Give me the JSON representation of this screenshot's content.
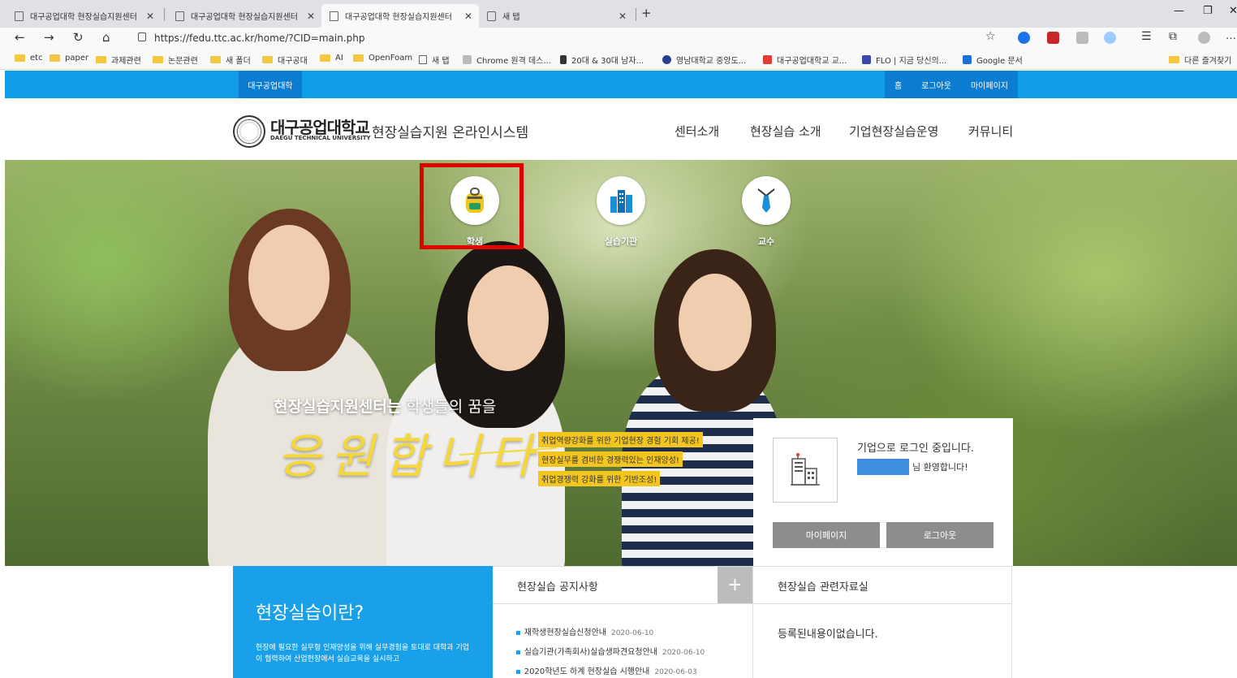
{
  "browser": {
    "tabs": [
      {
        "title": "대구공업대학 현장실습지원센터"
      },
      {
        "title": "대구공업대학 현장실습지원센터"
      },
      {
        "title": "대구공업대학 현장실습지원센터"
      },
      {
        "title": "새 탭"
      }
    ],
    "url": "https://fedu.ttc.ac.kr/home/?CID=main.php",
    "bookmarks": [
      {
        "label": "etc",
        "icon": "folder-icon"
      },
      {
        "label": "paper",
        "icon": "folder-icon"
      },
      {
        "label": "과제관련",
        "icon": "folder-icon"
      },
      {
        "label": "논문관련",
        "icon": "folder-icon"
      },
      {
        "label": "새 폴더",
        "icon": "folder-icon"
      },
      {
        "label": "대구공대",
        "icon": "folder-icon"
      },
      {
        "label": "AI",
        "icon": "folder-icon"
      },
      {
        "label": "OpenFoam",
        "icon": "folder-icon"
      },
      {
        "label": "새 탭",
        "icon": "page-icon"
      },
      {
        "label": "Chrome 원격 데스...",
        "icon": "remote-icon"
      },
      {
        "label": "20대 & 30대 남자...",
        "icon": "site-icon"
      },
      {
        "label": "영남대학교 중앙도...",
        "icon": "site-icon"
      },
      {
        "label": "대구공업대학교 교...",
        "icon": "site-icon"
      },
      {
        "label": "FLO | 지금 당신의...",
        "icon": "site-icon"
      },
      {
        "label": "Google 문서",
        "icon": "docs-icon"
      }
    ],
    "other_bookmarks": "다른 즐겨찾기"
  },
  "site": {
    "topbar": {
      "left_label": "대구공업대학",
      "links": [
        "홈",
        "로그아웃",
        "마이페이지"
      ]
    },
    "header": {
      "logo_kr": "대구공업대학교",
      "logo_en": "DAEGU TECHNICAL UNIVERSITY",
      "title": "현장실습지원 온라인시스템",
      "menu": [
        "센터소개",
        "현장실습 소개",
        "기업현장실습운영",
        "커뮤니티"
      ]
    },
    "hero": {
      "roles": [
        {
          "label": "학생",
          "icon": "backpack-icon"
        },
        {
          "label": "실습기관",
          "icon": "building-icon"
        },
        {
          "label": "교수",
          "icon": "necktie-icon"
        }
      ],
      "slogan_bold": "현장실습지원센터는",
      "slogan_rest": " 학생들의 꿈을",
      "slogan_script": "응원합니다",
      "tags": [
        "취업역량강화를 위한 기업현장 경험 기회 제공!",
        "현장실무를 겸비한 경쟁력있는 인재양성!",
        "취업경쟁력 강화를 위한 기반조성!"
      ]
    },
    "login": {
      "message": "기업으로 로그인 중입니다.",
      "welcome": "님 환영합니다!",
      "buttons": [
        "마이페이지",
        "로그아웃"
      ]
    },
    "about": {
      "title": "현장실습이란?",
      "text": "현장에 필요한 실무형 인재양성을 위해 실무경험을 토대로 대학과 기업이 협력하여 산업현장에서 실습교육을 실시하고"
    },
    "notice": {
      "title": "현장실습 공지사항",
      "more": "+",
      "items": [
        {
          "title": "재학생현장실습신청안내",
          "date": "2020-06-10"
        },
        {
          "title": "실습기관(가족회사)실습생파견요청안내",
          "date": "2020-06-10"
        },
        {
          "title": "2020학년도 하계 현장실습 시행안내",
          "date": "2020-06-03"
        }
      ]
    },
    "archive": {
      "title": "현장실습 관련자료실",
      "empty": "등록된내용이없습니다."
    }
  },
  "colors": {
    "brand_blue": "#0e9de6",
    "brand_dark_blue": "#0b7ccf",
    "tag_yellow": "#f2c51f",
    "highlight_red": "#e00000"
  }
}
